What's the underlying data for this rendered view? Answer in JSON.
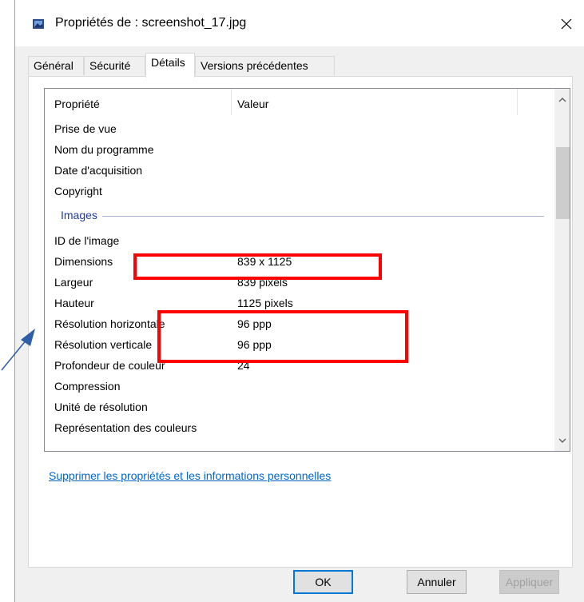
{
  "window": {
    "title": "Propriétés de : screenshot_17.jpg"
  },
  "tabs": [
    {
      "label": "Général"
    },
    {
      "label": "Sécurité"
    },
    {
      "label": "Détails"
    },
    {
      "label": "Versions précédentes"
    }
  ],
  "columns": {
    "property": "Propriété",
    "value": "Valeur"
  },
  "rows_top": [
    {
      "property": "Prise de vue",
      "value": ""
    },
    {
      "property": "Nom du programme",
      "value": ""
    },
    {
      "property": "Date d'acquisition",
      "value": ""
    },
    {
      "property": "Copyright",
      "value": ""
    }
  ],
  "group_images": "Images",
  "rows_images": [
    {
      "property": "ID de l'image",
      "value": ""
    },
    {
      "property": "Dimensions",
      "value": "839 x 1125"
    },
    {
      "property": "Largeur",
      "value": "839 pixels"
    },
    {
      "property": "Hauteur",
      "value": "1125 pixels"
    },
    {
      "property": "Résolution horizontale",
      "value": "96 ppp"
    },
    {
      "property": "Résolution verticale",
      "value": "96 ppp"
    },
    {
      "property": "Profondeur de couleur",
      "value": "24"
    },
    {
      "property": "Compression",
      "value": ""
    },
    {
      "property": "Unité de résolution",
      "value": ""
    },
    {
      "property": "Représentation des couleurs",
      "value": ""
    }
  ],
  "link_remove": "Supprimer les propriétés et les informations personnelles",
  "buttons": {
    "ok": "OK",
    "cancel": "Annuler",
    "apply": "Appliquer"
  },
  "colors": {
    "highlight": "#ff0000",
    "link": "#0066cc",
    "group": "#1e3c9e",
    "arrow": "#2f5ea8"
  }
}
